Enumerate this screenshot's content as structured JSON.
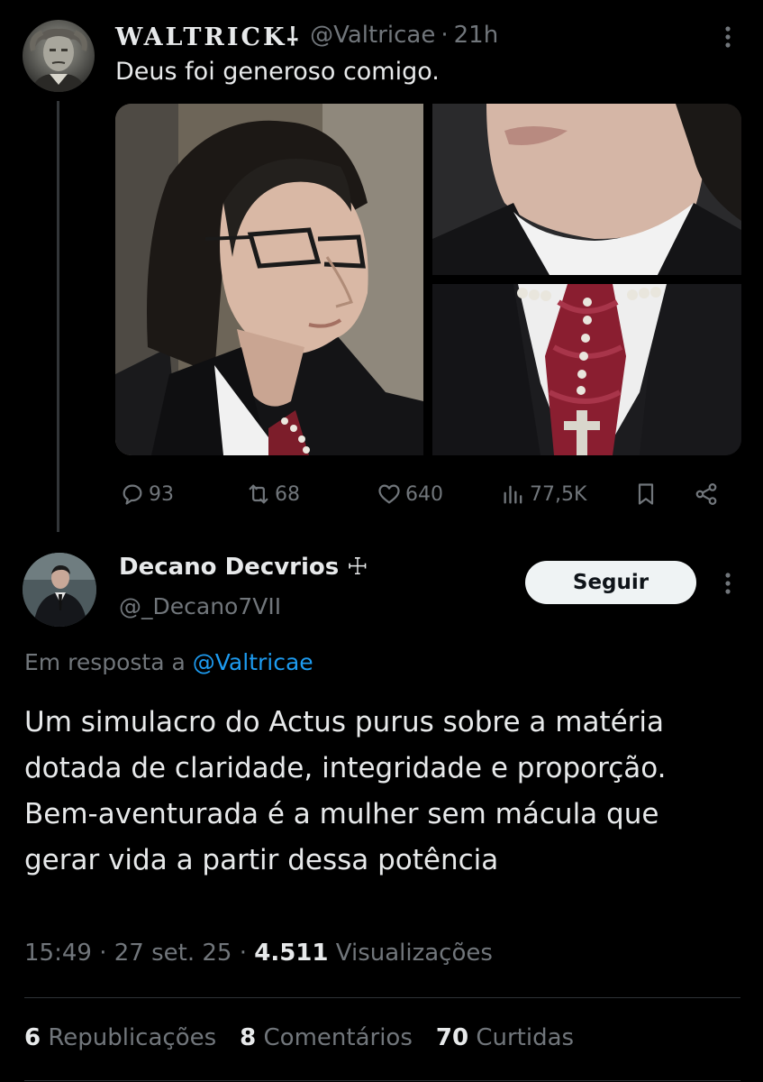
{
  "parent_tweet": {
    "display_name": "WALTRICK⸸",
    "handle": "@Valtricae",
    "separator": "·",
    "time": "21h",
    "text": "Deus foi generoso comigo.",
    "actions": {
      "replies": "93",
      "reposts": "68",
      "likes": "640",
      "views": "77,5K"
    }
  },
  "reply_tweet": {
    "display_name": "Decano Decvrios ☩",
    "handle": "@_Decano7VII",
    "follow_label": "Seguir",
    "reply_prefix": "Em resposta a",
    "reply_mention": "@Valtricae",
    "body": "Um simulacro do Actus purus sobre a matéria dotada de claridade, integridade e proporção. Bem-aventurada é a mulher sem mácula que gerar vida a partir dessa potência",
    "time": "15:49",
    "separator": "·",
    "date": "27 set. 25",
    "views_count": "4.511",
    "views_label": "Visualizações",
    "stats": {
      "reposts_count": "6",
      "reposts_label": "Republicações",
      "comments_count": "8",
      "comments_label": "Comentários",
      "likes_count": "70",
      "likes_label": "Curtidas"
    }
  },
  "icons": {
    "reply": "speech-bubble-icon",
    "repost": "repost-arrows-icon",
    "like": "heart-icon",
    "views": "bar-chart-icon",
    "bookmark": "bookmark-icon",
    "share": "share-icon",
    "more": "more-vertical-icon"
  },
  "colors": {
    "background": "#000000",
    "text_primary": "#e7e9ea",
    "text_secondary": "#71767b",
    "link": "#1d9bf0",
    "follow_button_bg": "#eff3f4",
    "divider": "#2f3336"
  }
}
